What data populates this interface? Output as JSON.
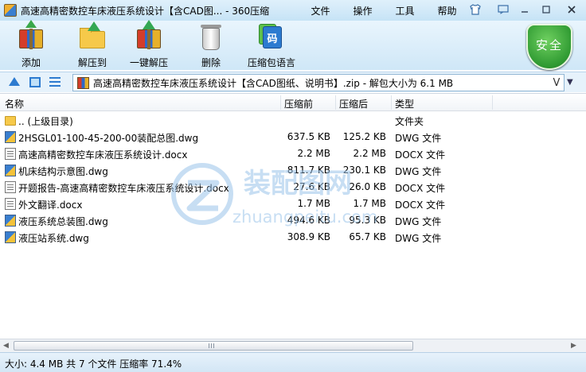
{
  "window": {
    "title": "高速高精密数控车床液压系统设计【含CAD图... - 360压缩"
  },
  "menu": [
    "文件",
    "操作",
    "工具",
    "帮助"
  ],
  "toolbar": {
    "add": "添加",
    "extract_to": "解压到",
    "one_click_extract": "一键解压",
    "delete": "删除",
    "archive_language": "压缩包语言"
  },
  "security_badge": "安全",
  "address": {
    "path": "高速高精密数控车床液压系统设计【含CAD图纸、说明书】.zip - 解包大小为 6.1 MB",
    "history_icon": "V"
  },
  "columns": {
    "name": "名称",
    "compressed": "压缩前",
    "original": "压缩后",
    "type": "类型"
  },
  "files": [
    {
      "name": ".. (上级目录)",
      "compressed": "",
      "original": "",
      "type": "文件夹",
      "icon": "folder"
    },
    {
      "name": "2HSGL01-100-45-200-00装配总图.dwg",
      "compressed": "637.5 KB",
      "original": "125.2 KB",
      "type": "DWG 文件",
      "icon": "dwg"
    },
    {
      "name": "高速高精密数控车床液压系统设计.docx",
      "compressed": "2.2 MB",
      "original": "2.2 MB",
      "type": "DOCX 文件",
      "icon": "docx"
    },
    {
      "name": "机床结构示意图.dwg",
      "compressed": "811.7 KB",
      "original": "230.1 KB",
      "type": "DWG 文件",
      "icon": "dwg"
    },
    {
      "name": "开题报告-高速高精密数控车床液压系统设计.docx",
      "compressed": "27.6 KB",
      "original": "26.0 KB",
      "type": "DOCX 文件",
      "icon": "docx"
    },
    {
      "name": "外文翻译.docx",
      "compressed": "1.7 MB",
      "original": "1.7 MB",
      "type": "DOCX 文件",
      "icon": "docx"
    },
    {
      "name": "液压系统总装图.dwg",
      "compressed": "494.6 KB",
      "original": "95.3 KB",
      "type": "DWG 文件",
      "icon": "dwg"
    },
    {
      "name": "液压站系统.dwg",
      "compressed": "308.9 KB",
      "original": "65.7 KB",
      "type": "DWG 文件",
      "icon": "dwg"
    }
  ],
  "watermark": {
    "text_cn": "装配图网",
    "text_en": "zhuangpeitu.com"
  },
  "status": "大小: 4.4 MB 共 7 个文件 压缩率 71.4%"
}
